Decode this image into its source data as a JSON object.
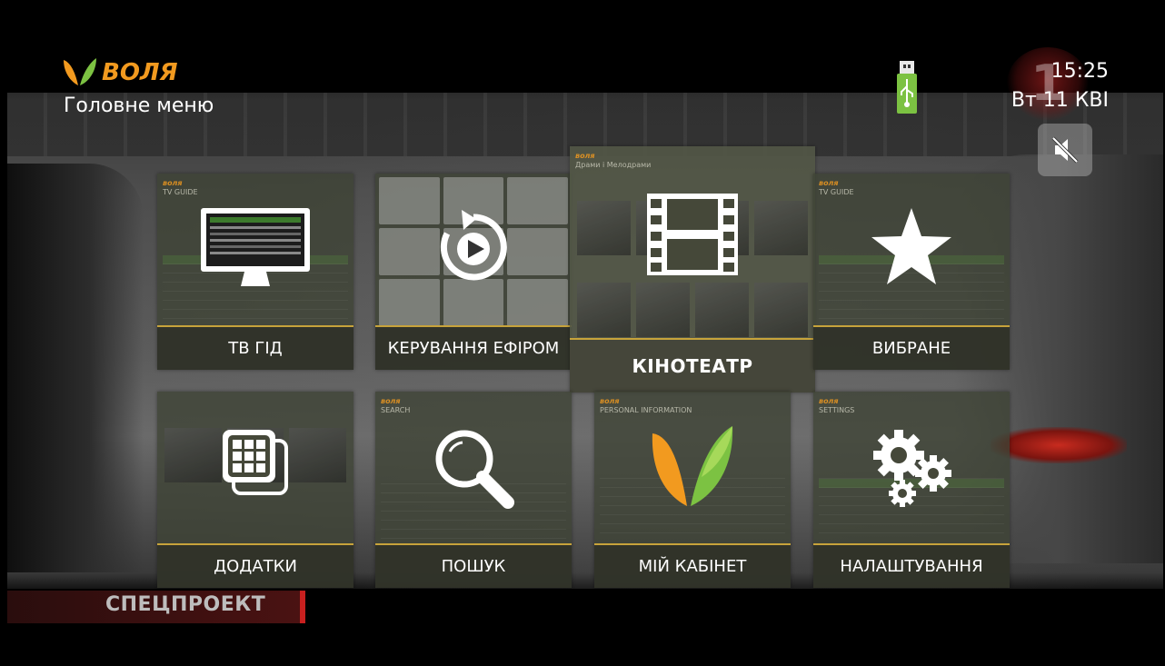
{
  "brand": {
    "name": "ВОЛЯ"
  },
  "header": {
    "title": "Головне меню"
  },
  "status": {
    "time": "15:25",
    "date": "Вт 11 КВІ",
    "usb_icon": "usb-icon",
    "mute_icon": "mute-icon"
  },
  "background": {
    "ticker": "СПЕЦПРОЕКТ",
    "channel_badge": "1"
  },
  "tiles": [
    {
      "label": "ТВ ГІД",
      "icon": "tv-guide-icon"
    },
    {
      "label": "КЕРУВАННЯ ЕФІРОМ",
      "icon": "replay-icon"
    },
    {
      "label": "КІНОТЕАТР",
      "icon": "film-icon"
    },
    {
      "label": "ВИБРАНЕ",
      "icon": "star-icon"
    },
    {
      "label": "ДОДАТКИ",
      "icon": "apps-icon"
    },
    {
      "label": "ПОШУК",
      "icon": "search-icon"
    },
    {
      "label": "МІЙ КАБІНЕТ",
      "icon": "cabinet-logo-icon"
    },
    {
      "label": "НАЛАШТУВАННЯ",
      "icon": "gears-icon"
    }
  ],
  "previews": {
    "tv_guide": {
      "header": "TV GUIDE"
    },
    "cinema": {
      "header": "Драми і Мелодрами"
    },
    "favorites": {
      "header": "TV GUIDE"
    },
    "search": {
      "header": "SEARCH"
    },
    "cabinet": {
      "header": "PERSONAL INFORMATION"
    },
    "settings": {
      "header": "SETTINGS"
    }
  },
  "colors": {
    "accent": "#c7a33b",
    "brand_orange": "#f29a1f",
    "brand_green": "#7cc242"
  }
}
